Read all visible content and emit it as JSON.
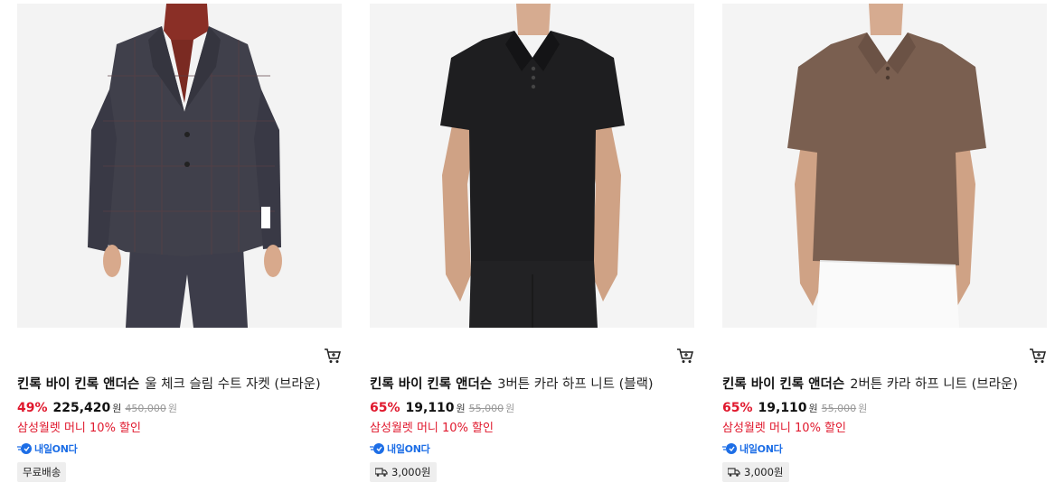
{
  "products": [
    {
      "brand": "킨록 바이 킨록 앤더슨",
      "name": "울 체크 슬림 수트 자켓 (브라운)",
      "discount": "49%",
      "price": "225,420",
      "currency": "원",
      "original_price": "450,000",
      "promo": "삼성월렛 머니 10% 할인",
      "fast_delivery": "내일ON다",
      "shipping": "무료배송",
      "has_truck_icon": false,
      "image": "man-in-plaid-suit-jacket"
    },
    {
      "brand": "킨록 바이 킨록 앤더슨",
      "name": "3버튼 카라 하프 니트 (블랙)",
      "discount": "65%",
      "price": "19,110",
      "currency": "원",
      "original_price": "55,000",
      "promo": "삼성월렛 머니 10% 할인",
      "fast_delivery": "내일ON다",
      "shipping": "3,000원",
      "has_truck_icon": true,
      "image": "man-in-black-knit-polo"
    },
    {
      "brand": "킨록 바이 킨록 앤더슨",
      "name": "2버튼 카라 하프 니트 (브라운)",
      "discount": "65%",
      "price": "19,110",
      "currency": "원",
      "original_price": "55,000",
      "promo": "삼성월렛 머니 10% 할인",
      "fast_delivery": "내일ON다",
      "shipping": "3,000원",
      "has_truck_icon": true,
      "image": "man-in-brown-knit-polo"
    }
  ],
  "colors": {
    "discount": "#e0182d",
    "fast_delivery": "#1d6ee6",
    "badge_bg": "#eeeeee"
  }
}
